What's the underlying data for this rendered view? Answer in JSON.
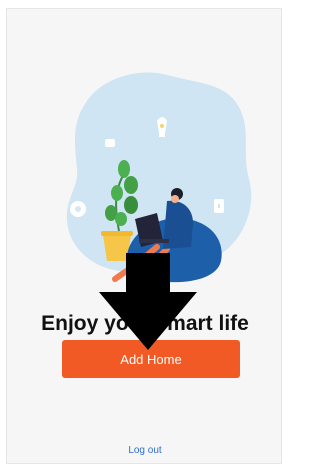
{
  "headline": "Enjoy your smart life",
  "add_home_button": {
    "label": "Add Home"
  },
  "log_out_link": {
    "label": "Log out"
  },
  "colors": {
    "accent": "#f15a24",
    "link": "#2f6fd6",
    "blob": "#cde4f2",
    "background": "#f6f6f7"
  },
  "icons": [
    "lightbulb-icon",
    "plant-illustration",
    "person-with-laptop-illustration",
    "beanbag-illustration",
    "down-arrow-annotation"
  ]
}
